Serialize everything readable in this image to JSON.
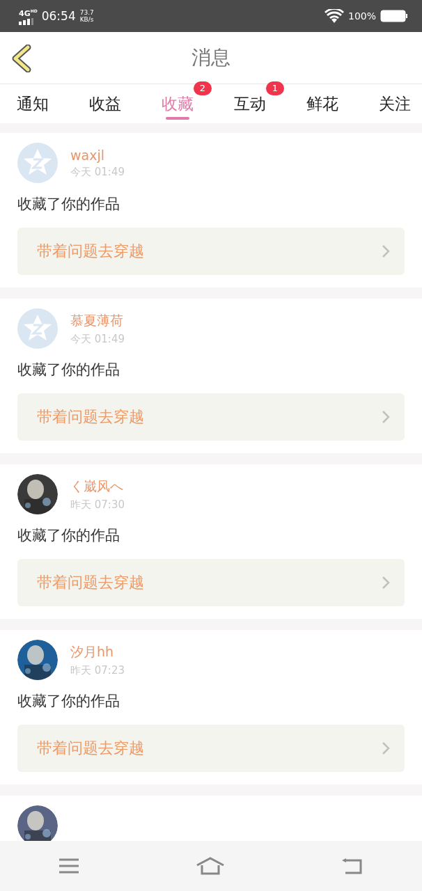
{
  "status_bar": {
    "network": "4G",
    "network_sub": "HD",
    "time": "06:54",
    "speed": "73.7",
    "speed_unit": "KB/s",
    "battery": "100%"
  },
  "header": {
    "title": "消息"
  },
  "tabs": [
    {
      "label": "通知",
      "selected": false
    },
    {
      "label": "收益",
      "selected": false
    },
    {
      "label": "收藏",
      "selected": true,
      "badge": "2"
    },
    {
      "label": "互动",
      "selected": false,
      "badge": "1"
    },
    {
      "label": "鲜花",
      "selected": false
    },
    {
      "label": "关注",
      "selected": false
    }
  ],
  "messages": [
    {
      "avatar": {
        "kind": "default"
      },
      "name": "waxjl",
      "time": "今天 01:49",
      "action": "收藏了你的作品",
      "work": "带着问题去穿越"
    },
    {
      "avatar": {
        "kind": "default"
      },
      "name": "慕夏薄荷",
      "time": "今天 01:49",
      "action": "收藏了你的作品",
      "work": "带着问题去穿越"
    },
    {
      "avatar": {
        "kind": "picture",
        "color": "#3a3a3a"
      },
      "name": "く崴风へ",
      "time": "昨天 07:30",
      "action": "收藏了你的作品",
      "work": "带着问题去穿越"
    },
    {
      "avatar": {
        "kind": "picture",
        "color": "#1f5f9a"
      },
      "name": "汐月hh",
      "time": "昨天 07:23",
      "action": "收藏了你的作品",
      "work": "带着问题去穿越"
    },
    {
      "avatar": {
        "kind": "picture",
        "color": "#5a6585"
      }
    }
  ]
}
